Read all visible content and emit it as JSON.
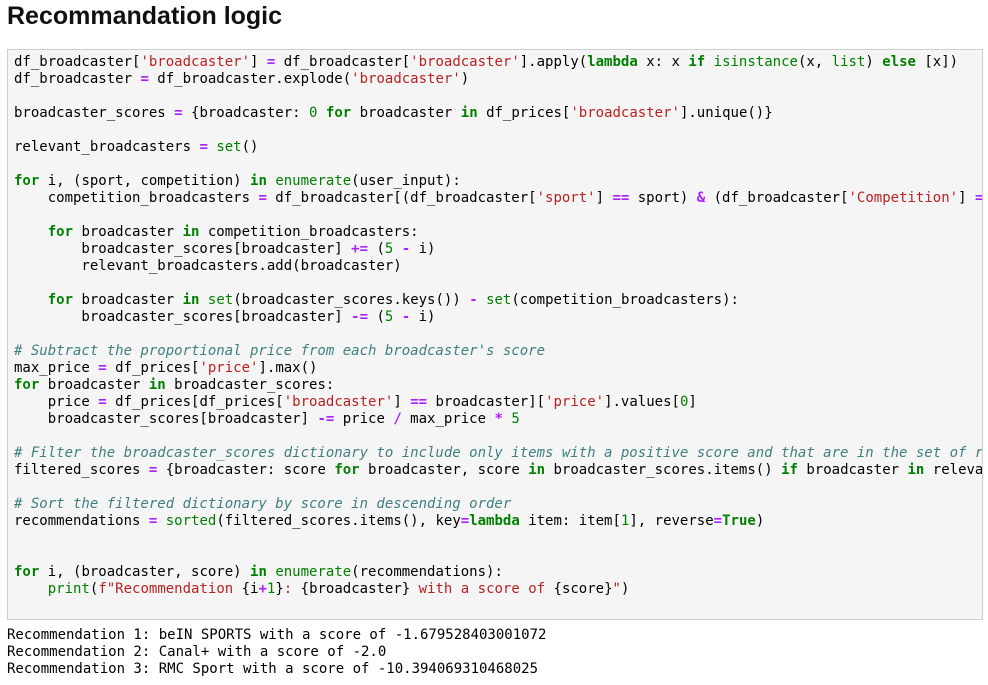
{
  "page": {
    "title": "Recommandation logic"
  },
  "code_cell": {
    "lines": [
      [
        [
          "df_broadcaster[",
          "n"
        ],
        [
          "'broadcaster'",
          "str"
        ],
        [
          "] ",
          "n"
        ],
        [
          "=",
          "op"
        ],
        [
          " df_broadcaster[",
          "n"
        ],
        [
          "'broadcaster'",
          "str"
        ],
        [
          "].apply(",
          "n"
        ],
        [
          "lambda",
          "kw"
        ],
        [
          " x: x ",
          "n"
        ],
        [
          "if",
          "kw"
        ],
        [
          " ",
          "n"
        ],
        [
          "isinstance",
          "bi"
        ],
        [
          "(x, ",
          "n"
        ],
        [
          "list",
          "bi"
        ],
        [
          ") ",
          "n"
        ],
        [
          "else",
          "kw"
        ],
        [
          " [x])",
          "n"
        ]
      ],
      [
        [
          "df_broadcaster ",
          "n"
        ],
        [
          "=",
          "op"
        ],
        [
          " df_broadcaster.explode(",
          "n"
        ],
        [
          "'broadcaster'",
          "str"
        ],
        [
          ")",
          "n"
        ]
      ],
      [],
      [
        [
          "broadcaster_scores ",
          "n"
        ],
        [
          "=",
          "op"
        ],
        [
          " {broadcaster: ",
          "n"
        ],
        [
          "0",
          "num"
        ],
        [
          " ",
          "n"
        ],
        [
          "for",
          "kw"
        ],
        [
          " broadcaster ",
          "n"
        ],
        [
          "in",
          "kw"
        ],
        [
          " df_prices[",
          "n"
        ],
        [
          "'broadcaster'",
          "str"
        ],
        [
          "].unique()}",
          "n"
        ]
      ],
      [],
      [
        [
          "relevant_broadcasters ",
          "n"
        ],
        [
          "=",
          "op"
        ],
        [
          " ",
          "n"
        ],
        [
          "set",
          "bi"
        ],
        [
          "()",
          "n"
        ]
      ],
      [],
      [
        [
          "for",
          "kw"
        ],
        [
          " i, (sport, competition) ",
          "n"
        ],
        [
          "in",
          "kw"
        ],
        [
          " ",
          "n"
        ],
        [
          "enumerate",
          "bi"
        ],
        [
          "(user_input):",
          "n"
        ]
      ],
      [
        [
          "    competition_broadcasters ",
          "n"
        ],
        [
          "=",
          "op"
        ],
        [
          " df_broadcaster[(df_broadcaster[",
          "n"
        ],
        [
          "'sport'",
          "str"
        ],
        [
          "] ",
          "n"
        ],
        [
          "==",
          "op"
        ],
        [
          " sport) ",
          "n"
        ],
        [
          "&",
          "op"
        ],
        [
          " (df_broadcaster[",
          "n"
        ],
        [
          "'Competition'",
          "str"
        ],
        [
          "] ",
          "n"
        ],
        [
          "==",
          "op"
        ]
      ],
      [],
      [
        [
          "    ",
          "n"
        ],
        [
          "for",
          "kw"
        ],
        [
          " broadcaster ",
          "n"
        ],
        [
          "in",
          "kw"
        ],
        [
          " competition_broadcasters:",
          "n"
        ]
      ],
      [
        [
          "        broadcaster_scores[broadcaster] ",
          "n"
        ],
        [
          "+=",
          "op"
        ],
        [
          " (",
          "n"
        ],
        [
          "5",
          "num"
        ],
        [
          " ",
          "n"
        ],
        [
          "-",
          "op"
        ],
        [
          " i)",
          "n"
        ]
      ],
      [
        [
          "        relevant_broadcasters.add(broadcaster)",
          "n"
        ]
      ],
      [],
      [
        [
          "    ",
          "n"
        ],
        [
          "for",
          "kw"
        ],
        [
          " broadcaster ",
          "n"
        ],
        [
          "in",
          "kw"
        ],
        [
          " ",
          "n"
        ],
        [
          "set",
          "bi"
        ],
        [
          "(broadcaster_scores.keys()) ",
          "n"
        ],
        [
          "-",
          "op"
        ],
        [
          " ",
          "n"
        ],
        [
          "set",
          "bi"
        ],
        [
          "(competition_broadcasters):",
          "n"
        ]
      ],
      [
        [
          "        broadcaster_scores[broadcaster] ",
          "n"
        ],
        [
          "-=",
          "op"
        ],
        [
          " (",
          "n"
        ],
        [
          "5",
          "num"
        ],
        [
          " ",
          "n"
        ],
        [
          "-",
          "op"
        ],
        [
          " i)",
          "n"
        ]
      ],
      [],
      [
        [
          "# Subtract the proportional price from each broadcaster's score",
          "cmt"
        ]
      ],
      [
        [
          "max_price ",
          "n"
        ],
        [
          "=",
          "op"
        ],
        [
          " df_prices[",
          "n"
        ],
        [
          "'price'",
          "str"
        ],
        [
          "].max()",
          "n"
        ]
      ],
      [
        [
          "for",
          "kw"
        ],
        [
          " broadcaster ",
          "n"
        ],
        [
          "in",
          "kw"
        ],
        [
          " broadcaster_scores:",
          "n"
        ]
      ],
      [
        [
          "    price ",
          "n"
        ],
        [
          "=",
          "op"
        ],
        [
          " df_prices[df_prices[",
          "n"
        ],
        [
          "'broadcaster'",
          "str"
        ],
        [
          "] ",
          "n"
        ],
        [
          "==",
          "op"
        ],
        [
          " broadcaster][",
          "n"
        ],
        [
          "'price'",
          "str"
        ],
        [
          "].values[",
          "n"
        ],
        [
          "0",
          "num"
        ],
        [
          "]",
          "n"
        ]
      ],
      [
        [
          "    broadcaster_scores[broadcaster] ",
          "n"
        ],
        [
          "-=",
          "op"
        ],
        [
          " price ",
          "n"
        ],
        [
          "/",
          "op"
        ],
        [
          " max_price ",
          "n"
        ],
        [
          "*",
          "op"
        ],
        [
          " ",
          "n"
        ],
        [
          "5",
          "num"
        ]
      ],
      [],
      [
        [
          "# Filter the broadcaster_scores dictionary to include only items with a positive score and that are in the set of re",
          "cmt"
        ]
      ],
      [
        [
          "filtered_scores ",
          "n"
        ],
        [
          "=",
          "op"
        ],
        [
          " {broadcaster: score ",
          "n"
        ],
        [
          "for",
          "kw"
        ],
        [
          " broadcaster, score ",
          "n"
        ],
        [
          "in",
          "kw"
        ],
        [
          " broadcaster_scores.items() ",
          "n"
        ],
        [
          "if",
          "kw"
        ],
        [
          " broadcaster ",
          "n"
        ],
        [
          "in",
          "kw"
        ],
        [
          " relevan",
          "n"
        ]
      ],
      [],
      [
        [
          "# Sort the filtered dictionary by score in descending order",
          "cmt"
        ]
      ],
      [
        [
          "recommendations ",
          "n"
        ],
        [
          "=",
          "op"
        ],
        [
          " ",
          "n"
        ],
        [
          "sorted",
          "bi"
        ],
        [
          "(filtered_scores.items(), key",
          "n"
        ],
        [
          "=",
          "op"
        ],
        [
          "lambda",
          "kw"
        ],
        [
          " item: item[",
          "n"
        ],
        [
          "1",
          "num"
        ],
        [
          "], reverse",
          "n"
        ],
        [
          "=",
          "op"
        ],
        [
          "True",
          "kw"
        ],
        [
          ")",
          "n"
        ]
      ],
      [],
      [],
      [
        [
          "for",
          "kw"
        ],
        [
          " i, (broadcaster, score) ",
          "n"
        ],
        [
          "in",
          "kw"
        ],
        [
          " ",
          "n"
        ],
        [
          "enumerate",
          "bi"
        ],
        [
          "(recommendations):",
          "n"
        ]
      ],
      [
        [
          "    ",
          "n"
        ],
        [
          "print",
          "bi"
        ],
        [
          "(",
          "n"
        ],
        [
          "f\"Recommendation ",
          "str"
        ],
        [
          "{i",
          "n"
        ],
        [
          "+",
          "op"
        ],
        [
          "1",
          "num"
        ],
        [
          "}",
          "n"
        ],
        [
          ": ",
          "str"
        ],
        [
          "{broadcaster}",
          "n"
        ],
        [
          " with a score of ",
          "str"
        ],
        [
          "{score}",
          "n"
        ],
        [
          "\"",
          "str"
        ],
        [
          ")",
          "n"
        ]
      ]
    ]
  },
  "output": {
    "lines": [
      "Recommendation 1: beIN SPORTS with a score of -1.679528403001072",
      "Recommendation 2: Canal+ with a score of -2.0",
      "Recommendation 3: RMC Sport with a score of -10.394069310468025"
    ]
  }
}
